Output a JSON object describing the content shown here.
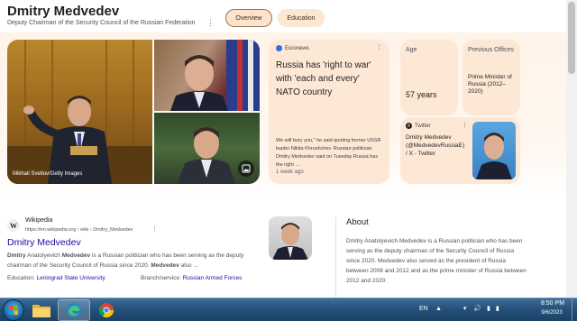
{
  "header": {
    "title": "Dmitry Medvedev",
    "subtitle": "Deputy Chairman of the Security Council of the Russian Federation",
    "more_icon": "more-vert-icon",
    "tabs": [
      {
        "label": "Overview",
        "selected": true
      },
      {
        "label": "Education",
        "selected": false
      }
    ]
  },
  "collage": {
    "credit": "Mikhail Svetlov/Getty Images",
    "gallery_icon": "image-gallery-icon"
  },
  "news": {
    "source": "Euronews",
    "headline": "Russia has 'right to war' with 'each and every' NATO country",
    "snippet": "We will bury you,\" he said quoting former USSR leader Nikita Khrushchev. Russian politician Dmitry Medvedev said on Tuesday Russia has the right ...",
    "time": "1 week ago"
  },
  "facts": {
    "age_label": "Age",
    "age_value": "57 years",
    "offices_label": "Previous Offices",
    "offices_value": "Prime Minister of Russia (2012–2020)"
  },
  "twitter": {
    "source": "Twitter",
    "text": "Dmitry Medvedev (@MedvedevRussiaE) / X - Twitter"
  },
  "result": {
    "site": "Wikipedia",
    "url": "https://en.wikipedia.org › wiki › Dmitry_Medvedev",
    "title": "Dmitry Medvedev",
    "snippet_b1": "Dmitry",
    "snippet_t1": " Anatolyevich ",
    "snippet_b2": "Medvedev",
    "snippet_t2": " is a Russian politician who has been serving as the deputy chairman of the Security Council of Russia since 2020. ",
    "snippet_b3": "Medvedev",
    "snippet_t3": " also ...",
    "education_label": "Education:",
    "education_value": "Leningrad State University",
    "branch_label": "Branch/service:",
    "branch_value": "Russian Armed Forces"
  },
  "about": {
    "title": "About",
    "text": "Dmitry Anatolyevich Medvedev is a Russian politician who has been serving as the deputy chairman of the Security Council of Russia since 2020. Medvedev also served as the president of Russia between 2008 and 2012 and as the prime minister of Russia between 2012 and 2020."
  },
  "taskbar": {
    "apps": [
      "folder-icon",
      "edge-icon",
      "chrome-icon"
    ],
    "language": "EN",
    "time": "8:50 PM",
    "date": "9/6/2023"
  },
  "colors": {
    "panel": "#fff4ea",
    "card": "#fde8d6",
    "link": "#1a0dab",
    "taskbar": "#234f78"
  }
}
